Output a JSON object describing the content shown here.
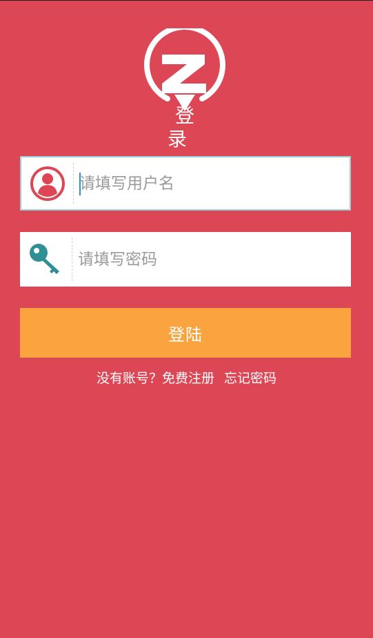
{
  "header": {
    "title": "登 录",
    "logo_icon": "z-pin-logo-icon"
  },
  "form": {
    "username": {
      "icon": "user-avatar-icon",
      "placeholder": "请填写用户名",
      "value": ""
    },
    "password": {
      "icon": "key-icon",
      "placeholder": "请填写密码",
      "value": ""
    },
    "login_label": "登陆"
  },
  "links": {
    "register": "没有账号？免费注册",
    "forgot": "忘记密码"
  },
  "colors": {
    "background": "#dd4655",
    "button": "#fba43f",
    "accent_icon_user": "#dd4655",
    "accent_icon_key": "#2f8f95",
    "focus_border": "#9bd1d6"
  }
}
